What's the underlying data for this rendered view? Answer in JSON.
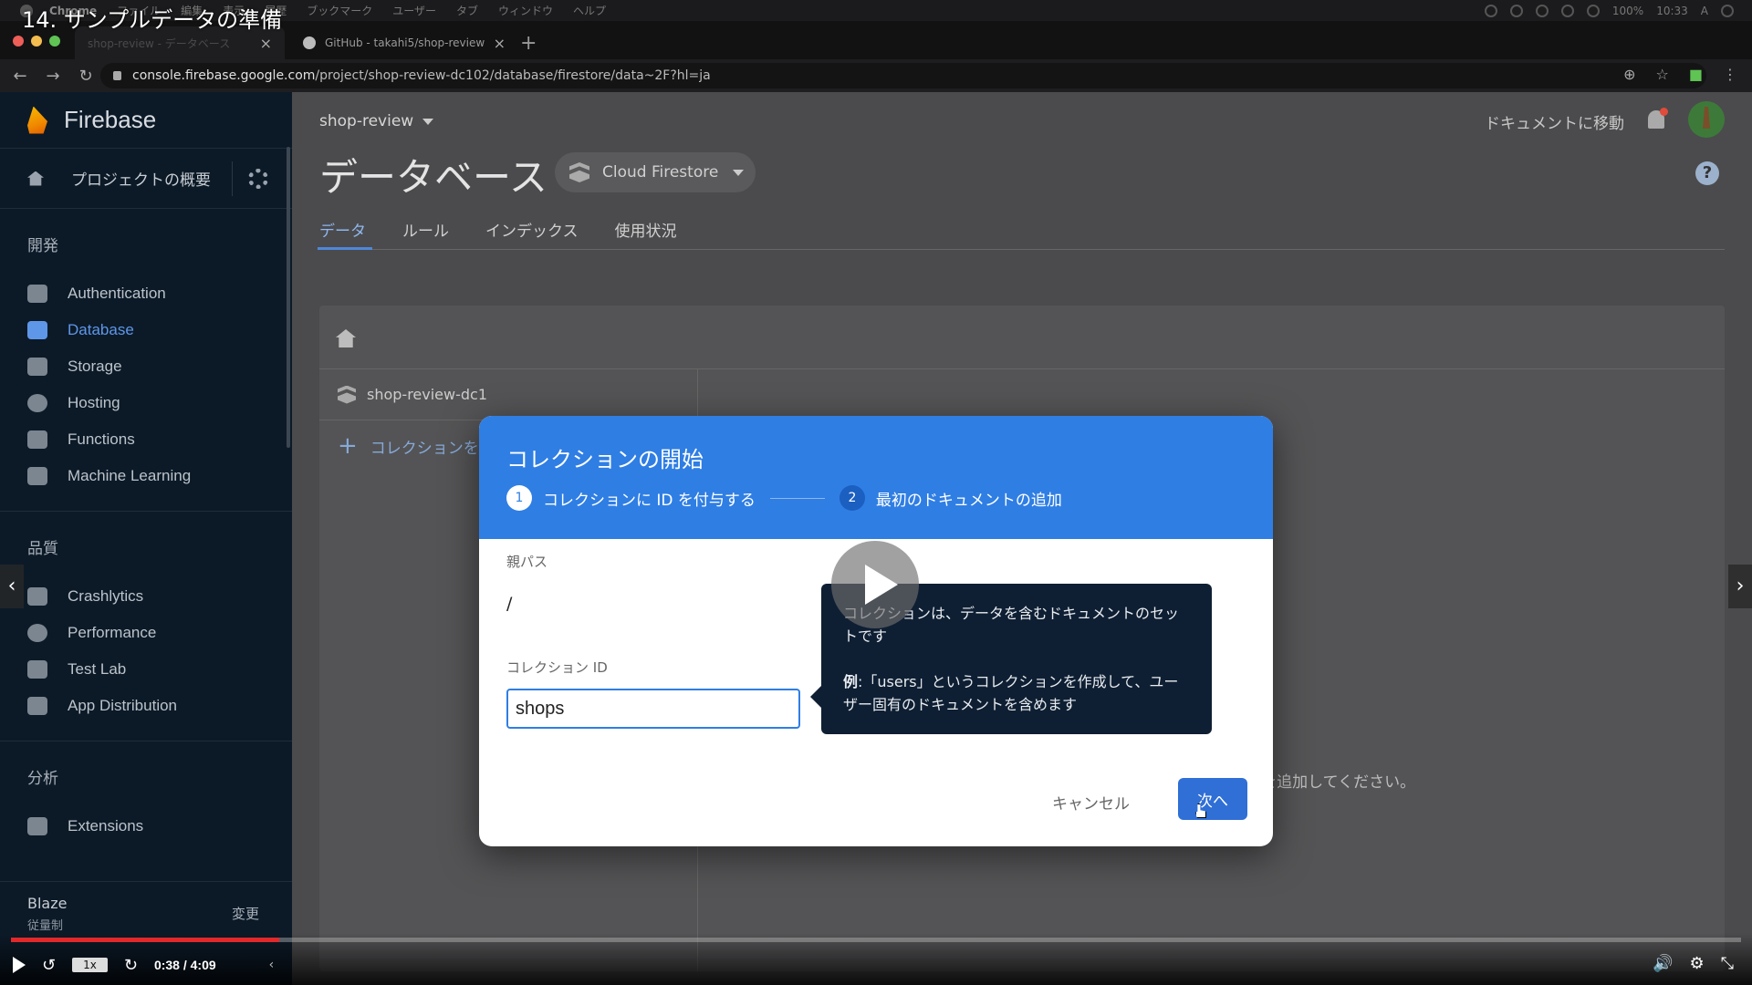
{
  "menubar": {
    "items": [
      "Chrome",
      "ファイル",
      "編集",
      "表示",
      "履歴",
      "ブックマーク",
      "ユーザー",
      "タブ",
      "ウィンドウ",
      "ヘルプ"
    ],
    "battery": "100%",
    "clock": "10:33",
    "input_indicator": "A"
  },
  "video": {
    "title": "14. サンプルデータの準備",
    "progress": 0.155,
    "speed": "1x",
    "time": "0:38 / 4:09",
    "play_icon": "play-icon",
    "replay_icon": "rewind-icon",
    "forward_icon": "forward-icon",
    "volume_icon": "volume-icon",
    "settings_icon": "gear-icon",
    "exit_fullscreen_icon": "compress-icon"
  },
  "browser": {
    "tabs": [
      {
        "label": "shop-review - データベース",
        "close": "×"
      },
      {
        "label": "GitHub - takahi5/shop-review",
        "close": "×"
      }
    ],
    "new_tab": "+",
    "url_host": "console.firebase.google.com",
    "url_path": "/project/shop-review-dc102/database/firestore/data~2F?hl=ja"
  },
  "sidebar": {
    "brand": "Firebase",
    "overview": "プロジェクトの概要",
    "sections": {
      "develop": "開発",
      "quality": "品質",
      "analytics": "分析"
    },
    "develop_items": [
      {
        "label": "Authentication",
        "icon": "users-icon"
      },
      {
        "label": "Database",
        "icon": "database-icon"
      },
      {
        "label": "Storage",
        "icon": "image-icon"
      },
      {
        "label": "Hosting",
        "icon": "globe-icon"
      },
      {
        "label": "Functions",
        "icon": "functions-icon"
      },
      {
        "label": "Machine Learning",
        "icon": "robot-icon"
      }
    ],
    "quality_items": [
      {
        "label": "Crashlytics",
        "icon": "crashlytics-icon"
      },
      {
        "label": "Performance",
        "icon": "speedometer-icon"
      },
      {
        "label": "Test Lab",
        "icon": "checklist-icon"
      },
      {
        "label": "App Distribution",
        "icon": "distribution-icon"
      }
    ],
    "analytics_items": [
      {
        "label": "Extensions",
        "icon": "puzzle-icon"
      }
    ],
    "plan": {
      "name": "Blaze",
      "sub": "従量制",
      "change": "変更"
    }
  },
  "main": {
    "project": "shop-review",
    "goto_docs": "ドキュメントに移動",
    "title": "データベース",
    "db_select": "Cloud Firestore",
    "help": "?",
    "tabs": [
      "データ",
      "ルール",
      "インデックス",
      "使用状況"
    ],
    "active_tab": 0,
    "collection_root": "shop-review-dc1",
    "add_collection": "コレクションを",
    "empty_message": "データベースの準備ができました。データを追加してください。"
  },
  "modal": {
    "title": "コレクションの開始",
    "steps": [
      {
        "num": "1",
        "label": "コレクションに ID を付与する"
      },
      {
        "num": "2",
        "label": "最初のドキュメントの追加"
      }
    ],
    "parent_path_label": "親パス",
    "parent_path": "/",
    "collection_id_label": "コレクション ID",
    "collection_id_value": "shops",
    "tooltip_line1": "コレクションは、データを含むドキュメントのセットです",
    "tooltip_example_label": "例",
    "tooltip_example": ":「users」というコレクションを作成して、ユーザー固有のドキュメントを含めます",
    "cancel": "キャンセル",
    "next": "次へ"
  },
  "colors": {
    "firebase_blue": "#2f7ee4",
    "sidebar_bg": "#0c1a28",
    "progress_red": "#e2282a"
  }
}
